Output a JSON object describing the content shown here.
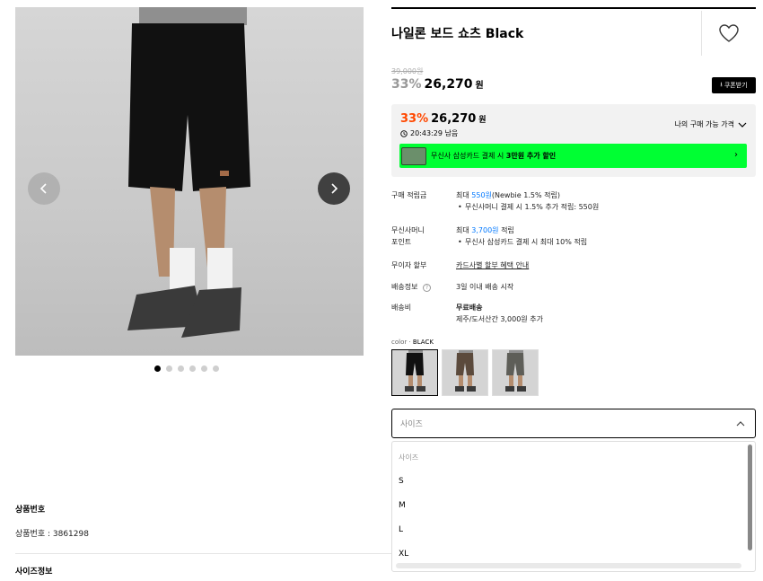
{
  "product": {
    "title": "나일론 보드 쇼츠 Black",
    "original_price": "39,000원",
    "discount_percent": "33%",
    "discount_price": "26,270",
    "price_unit": "원",
    "coupon_label": "쿠폰받기"
  },
  "best_price": {
    "percent": "33%",
    "price": "26,270",
    "unit": "원",
    "timer": "20:43:29 남음",
    "my_price_label": "나의 구매 가능 가격",
    "promo_prefix": "무신사 삼성카드 결제 시 ",
    "promo_bold": "3만원 추가 할인",
    "accent_color": "#ff4800",
    "promo_color": "#00ff33"
  },
  "specs": {
    "points_label": "구매 적립금",
    "points_prefix": "최대 ",
    "points_value": "550원",
    "points_suffix": "(Newbie 1.5% 적립)",
    "points_note": "무신사머니 결제 시 1.5% 추가 적립: 550원",
    "money_label_1": "무신사머니",
    "money_label_2": "포인트",
    "money_prefix": "최대 ",
    "money_value": "3,700원",
    "money_suffix": " 적립",
    "money_note": "무신사 삼성카드 결제 시 최대 10% 적립",
    "installment_label": "무이자 할부",
    "installment_link": "카드사별 할부 혜택 안내",
    "delivery_label": "배송정보",
    "delivery_value": "3일 이내 배송 시작",
    "shipping_label": "배송비",
    "shipping_value": "무료배송",
    "shipping_note": "제주/도서산간 3,000원 추가"
  },
  "color": {
    "label": "color · ",
    "value": "BLACK"
  },
  "size": {
    "placeholder": "사이즈",
    "options_placeholder": "사이즈",
    "options": [
      "S",
      "M",
      "L",
      "XL"
    ]
  },
  "info": {
    "product_no_title": "상품번호",
    "product_no_text": "상품번호 : 3861298",
    "size_info_title": "사이즈정보"
  },
  "gallery": {
    "slide_count": 6,
    "active_slide": 1
  }
}
